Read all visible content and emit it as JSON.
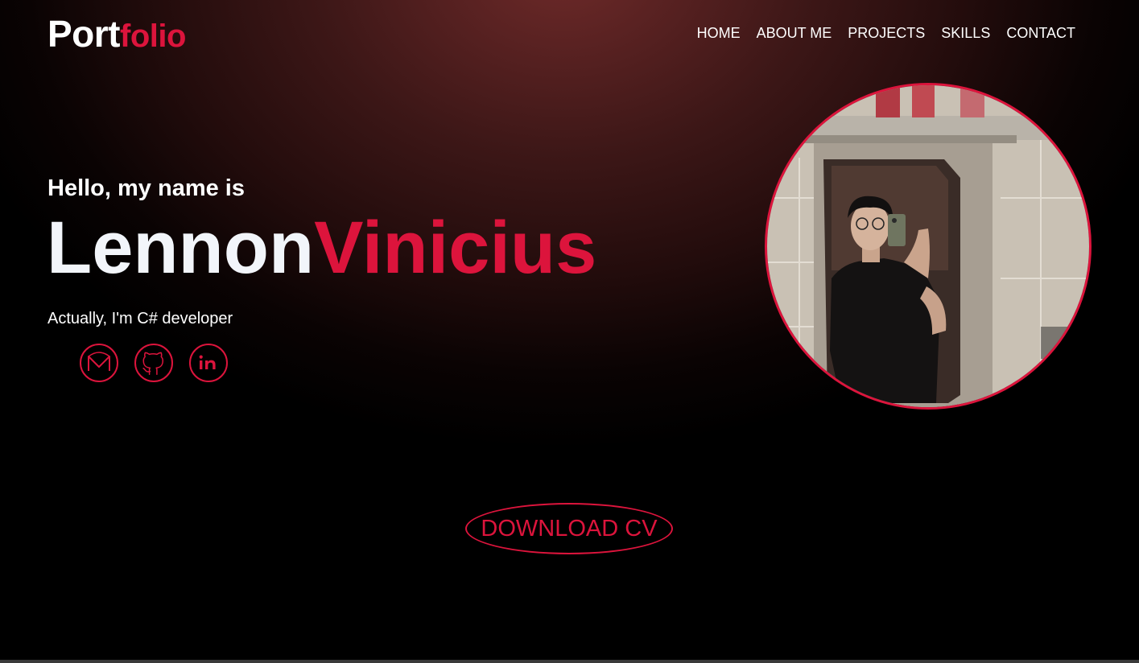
{
  "header": {
    "logo_primary": "Port",
    "logo_accent": "folio",
    "nav": [
      "HOME",
      "ABOUT ME",
      "PROJECTS",
      "SKILLS",
      "CONTACT"
    ]
  },
  "hero": {
    "greeting": "Hello, my name is",
    "first_name": "Lennon",
    "last_name": "Vinicius",
    "tagline": "Actually, I'm C# developer",
    "socials": [
      {
        "icon": "mail-icon"
      },
      {
        "icon": "github-icon"
      },
      {
        "icon": "linkedin-icon"
      }
    ],
    "photo_icon": "profile-photo",
    "cta_label": "DOWNLOAD CV"
  },
  "colors": {
    "accent": "#dc143c",
    "text": "#ffffff",
    "background": "#000000",
    "glow": "#6e2a29"
  }
}
